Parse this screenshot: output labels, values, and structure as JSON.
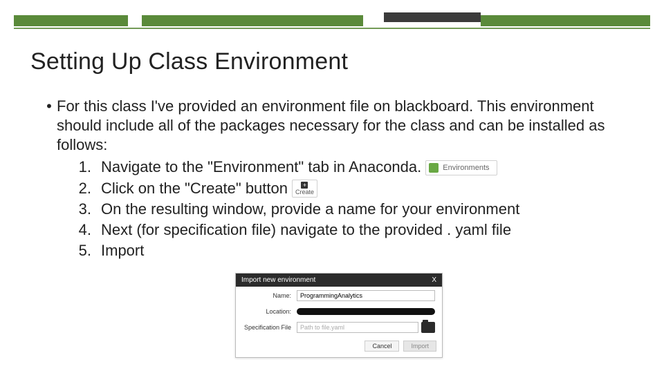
{
  "title": "Setting Up Class Environment",
  "bullet": {
    "intro": "For this class I've provided an environment file on blackboard. This environment should include all of the packages necessary for the class and can be installed as follows:",
    "steps": {
      "s1_num": "1.",
      "s1_text": "Navigate to the \"Environment\" tab in Anaconda.",
      "s2_num": "2.",
      "s2_text": "Click on the \"Create\" button",
      "s3_num": "3.",
      "s3_text": "On the resulting window, provide a name for your environment",
      "s4_num": "4.",
      "s4_text": "Next (for specification file) navigate to the provided . yaml file",
      "s5_num": "5.",
      "s5_text": "Import"
    }
  },
  "chips": {
    "environments_label": "Environments",
    "create_label": "Create"
  },
  "dialog": {
    "title": "Import new environment",
    "close": "X",
    "name_label": "Name:",
    "name_value": "ProgrammingAnalytics",
    "location_label": "Location:",
    "specfile_label": "Specification File",
    "specfile_placeholder": "Path to file.yaml",
    "cancel": "Cancel",
    "import": "Import"
  }
}
